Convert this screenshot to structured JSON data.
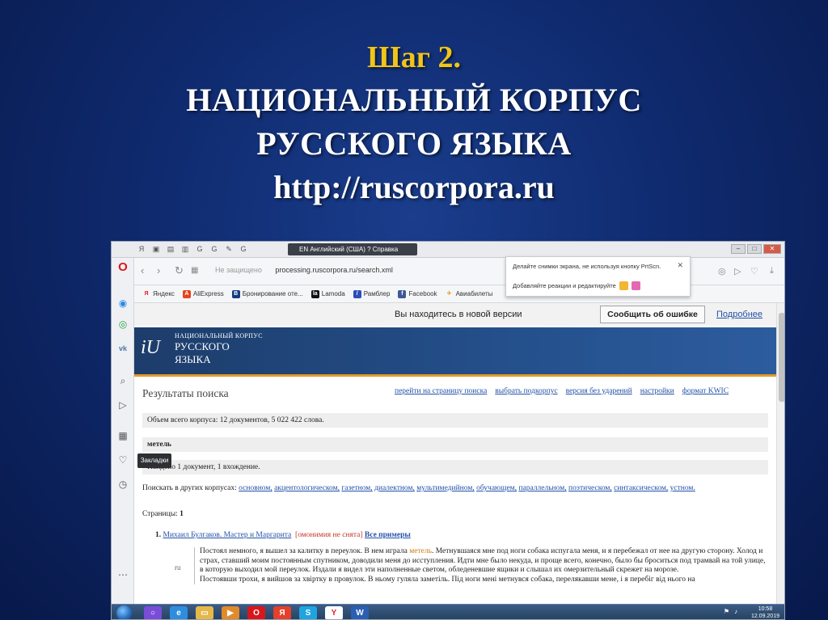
{
  "slide": {
    "step": "Шаг 2.",
    "title_line1": "НАЦИОНАЛЬНЫЙ КОРПУС",
    "title_line2": "РУССКОГО ЯЗЫКА",
    "url": "http://ruscorpora.ru"
  },
  "browser": {
    "langbar_text": "EN Английский (США)   ? Справка",
    "url_protocol": "Не защищено",
    "url_host": "processing.ruscorpora.ru/search.xml",
    "bookmarks": [
      {
        "label": "Яндекс",
        "icon": "yandex-icon",
        "color": "#e4202a",
        "glyph": "Я"
      },
      {
        "label": "AliExpress",
        "icon": "aliexpress-icon",
        "color": "#e8421d",
        "glyph": "A"
      },
      {
        "label": "Бронирование оте...",
        "icon": "booking-icon",
        "color": "#143a82",
        "glyph": "B"
      },
      {
        "label": "Lamoda",
        "icon": "lamoda-icon",
        "color": "#111111",
        "glyph": "la"
      },
      {
        "label": "Рамблер",
        "icon": "rambler-icon",
        "color": "#2a4fb8",
        "glyph": "/"
      },
      {
        "label": "Facebook",
        "icon": "facebook-icon",
        "color": "#3b5998",
        "glyph": "f"
      },
      {
        "label": "Авиабилеты",
        "icon": "plane-icon",
        "color": "#e6a21b",
        "glyph": "✈"
      }
    ],
    "popup": {
      "line1": "Делайте снимки экрана, не используя кнопку PrtScn.",
      "line2": "Добавляйте реакции и редактируйте"
    },
    "tooltip": "Закладки"
  },
  "page": {
    "new_version_msg": "Вы находитесь в новой версии",
    "report_button": "Сообщить об ошибке",
    "older_link": "Подробнее",
    "logo_line1": "НАЦИОНАЛЬНЫЙ КОРПУС",
    "logo_line2": "РУССКОГО",
    "logo_line3": "ЯЗЫКА",
    "results_title": "Результаты поиска",
    "top_links": [
      "перейти на страницу поиска",
      "выбрать подкорпус",
      "версия без ударений",
      "настройки",
      "формат KWIC"
    ],
    "corpus_size": "Объем всего корпуса: 12 документов, 5 022 422 слова.",
    "query": "метель",
    "found": "Найдено 1 документ, 1 вхождение.",
    "other_corpora_label": "Поискать в других корпусах:",
    "other_corpora": [
      "основном,",
      "акцентологическом,",
      "газетном,",
      "диалектном,",
      "мультимедийном,",
      "обучающем,",
      "параллельном,",
      "поэтическом,",
      "синтаксическом,",
      "устном."
    ],
    "pages_label": "Страницы:",
    "pages_value": "1",
    "doc_number": "1.",
    "doc_author": "Михаил Булгаков. Мастер и Маргарита",
    "doc_homonymy": "[омонимия не снята]",
    "doc_all": "Все примеры",
    "lang_label": "ru",
    "snippet_pre": "Постоял немного, я вышел за калитку в переулок. В нем играла ",
    "snippet_hl": "метель",
    "snippet_post": ". Метнувшаяся мне под ноги собака испугала меня, и я перебежал от нее на другую сторону. Холод и страх, ставший моим постоянным спутником, доводили меня до исступления. Идти мне было некуда, и проще всего, конечно, было бы броситься под трамвай на той улице, в которую выходил мой переулок. Издали я видел эти наполненные светом, обледеневшие ящики и слышал их омерзительный скрежет на морозе.",
    "snippet_uk": "Постоявши трохи, я вийшов за хвіртку в провулок. В ньому гуляла заметіль. Під ноги мені метнувся собака, перелякавши мене, і я перебіг від нього на"
  },
  "taskbar": {
    "time": "10:58",
    "date": "12.09.2019",
    "items": [
      {
        "icon": "alice-icon",
        "color": "#7a4dd8",
        "glyph": "○"
      },
      {
        "icon": "ie-icon",
        "color": "#2f8de0",
        "glyph": "e"
      },
      {
        "icon": "folder-icon",
        "color": "#e6b84a",
        "glyph": "▭"
      },
      {
        "icon": "media-icon",
        "color": "#e08a2a",
        "glyph": "▶"
      },
      {
        "icon": "opera-icon",
        "color": "#d8171a",
        "glyph": "O"
      },
      {
        "icon": "yandex-browser-icon",
        "color": "#e4402a",
        "glyph": "Я"
      },
      {
        "icon": "skype-icon",
        "color": "#1fa4e0",
        "glyph": "S"
      },
      {
        "icon": "yandex-y-icon",
        "color": "#ffffff",
        "glyph": "Y"
      },
      {
        "icon": "word-icon",
        "color": "#2b5fb3",
        "glyph": "W"
      }
    ]
  }
}
